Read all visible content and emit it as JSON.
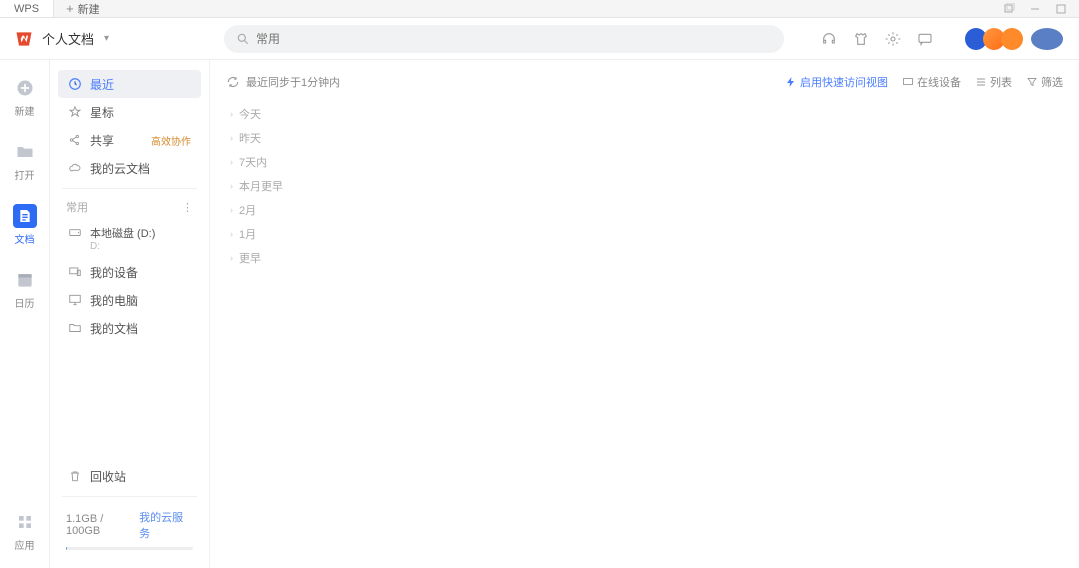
{
  "titlebar": {
    "wps": "WPS",
    "new": "新建"
  },
  "brand": {
    "title": "个人文档"
  },
  "search": {
    "placeholder": "常用"
  },
  "rail": {
    "new": "新建",
    "open": "打开",
    "docs": "文档",
    "calendar": "日历",
    "apps": "应用"
  },
  "sidebar": {
    "recent": "最近",
    "star": "星标",
    "share": "共享",
    "share_badge": "高效协作",
    "mycloud": "我的云文档",
    "group": "常用",
    "localdisk": {
      "title": "本地磁盘 (D:)",
      "sub": "D:"
    },
    "devices": "我的设备",
    "computer": "我的电脑",
    "mydocs": "我的文档",
    "trash": "回收站",
    "storage": "1.1GB / 100GB",
    "cloud_link": "我的云服务"
  },
  "main": {
    "sync": "最近同步于1分钟内",
    "quick": "启用快速访问视图",
    "online": "在线设备",
    "list": "列表",
    "filter": "筛选",
    "groups": [
      "今天",
      "昨天",
      "7天内",
      "本月更早",
      "2月",
      "1月",
      "更早"
    ]
  }
}
